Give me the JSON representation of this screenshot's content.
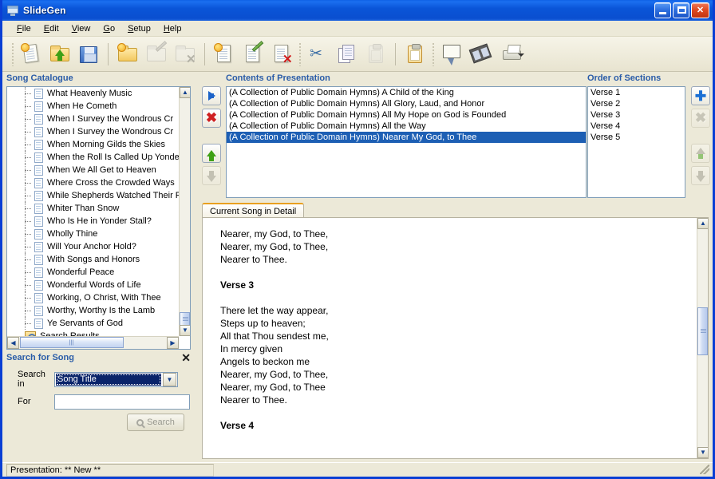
{
  "window": {
    "title": "SlideGen",
    "icon": "presentation-screen-icon",
    "controls": {
      "minimize": "Minimize",
      "maximize": "Maximize",
      "close": "Close"
    }
  },
  "menu": {
    "items": [
      {
        "label": "File",
        "accel": "F"
      },
      {
        "label": "Edit",
        "accel": "E"
      },
      {
        "label": "View",
        "accel": "V"
      },
      {
        "label": "Go",
        "accel": "G"
      },
      {
        "label": "Setup",
        "accel": "S"
      },
      {
        "label": "Help",
        "accel": "H"
      }
    ]
  },
  "toolbar": {
    "buttons": [
      {
        "name": "new-presentation-icon",
        "enabled": true
      },
      {
        "name": "open-presentation-icon",
        "enabled": true
      },
      {
        "name": "save-presentation-icon",
        "enabled": true
      },
      {
        "name": "new-folder-icon",
        "enabled": true
      },
      {
        "name": "edit-folder-icon",
        "enabled": false
      },
      {
        "name": "delete-folder-icon",
        "enabled": false
      },
      {
        "name": "new-song-icon",
        "enabled": true
      },
      {
        "name": "edit-song-icon",
        "enabled": true
      },
      {
        "name": "delete-song-icon",
        "enabled": true
      },
      {
        "name": "cut-icon",
        "enabled": true
      },
      {
        "name": "copy-icon",
        "enabled": true
      },
      {
        "name": "paste-disabled-icon",
        "enabled": false
      },
      {
        "name": "paste-icon",
        "enabled": true
      },
      {
        "name": "present-screen-icon",
        "enabled": true
      },
      {
        "name": "film-icon",
        "enabled": true
      },
      {
        "name": "print-icon",
        "enabled": true
      }
    ]
  },
  "catalogue": {
    "title": "Song Catalogue",
    "songs": [
      "What Heavenly Music",
      "When He Cometh",
      "When I Survey the Wondrous Cr",
      "When I Survey the Wondrous Cr",
      "When Morning Gilds the Skies",
      "When the Roll Is Called Up Yonde",
      "When We All Get to Heaven",
      "Where Cross the Crowded Ways",
      "While Shepherds Watched Their F",
      "Whiter Than Snow",
      "Who Is He in Yonder Stall?",
      "Wholly Thine",
      "Will Your Anchor Hold?",
      "With Songs and Honors",
      "Wonderful Peace",
      "Wonderful Words of Life",
      "Working, O Christ, With Thee",
      "Worthy, Worthy Is the Lamb",
      "Ye Servants of God"
    ],
    "search_results_node": "Search Results"
  },
  "transfer_buttons": [
    {
      "name": "add-to-presentation-button",
      "icon": "blue-right-arrow-icon",
      "enabled": true
    },
    {
      "name": "remove-from-presentation-button",
      "icon": "red-x-icon",
      "enabled": true
    },
    {
      "name": "move-up-button",
      "icon": "green-up-arrow-icon",
      "enabled": true
    },
    {
      "name": "move-down-button",
      "icon": "grey-down-arrow-icon",
      "enabled": false
    }
  ],
  "contents": {
    "title": "Contents of Presentation",
    "items": [
      {
        "text": "(A Collection of Public Domain Hymns) A Child of the King",
        "selected": false
      },
      {
        "text": "(A Collection of Public Domain Hymns) All Glory, Laud, and Honor",
        "selected": false
      },
      {
        "text": "(A Collection of Public Domain Hymns) All My Hope on God is Founded",
        "selected": false
      },
      {
        "text": "(A Collection of Public Domain Hymns) All the Way",
        "selected": false
      },
      {
        "text": "(A Collection of Public Domain Hymns) Nearer My God, to Thee",
        "selected": true
      }
    ]
  },
  "order": {
    "title": "Order of Sections",
    "items": [
      "Verse 1",
      "Verse 2",
      "Verse 3",
      "Verse 4",
      "Verse 5"
    ],
    "buttons": [
      {
        "name": "add-section-button",
        "icon": "blue-plus-icon",
        "enabled": true
      },
      {
        "name": "remove-section-button",
        "icon": "grey-x-icon",
        "enabled": false
      },
      {
        "name": "section-up-button",
        "icon": "grey-up-arrow-icon",
        "enabled": false
      },
      {
        "name": "section-down-button",
        "icon": "grey-down-arrow-icon",
        "enabled": false
      }
    ]
  },
  "detail": {
    "tab_label": "Current Song in Detail",
    "lines": [
      {
        "text": "Nearer, my God, to Thee,",
        "style": "normal"
      },
      {
        "text": "Nearer, my God, to Thee,",
        "style": "normal"
      },
      {
        "text": "Nearer to Thee.",
        "style": "normal"
      },
      {
        "text": "",
        "style": "blank"
      },
      {
        "text": "Verse 3",
        "style": "heading"
      },
      {
        "text": "",
        "style": "blank"
      },
      {
        "text": "There let the way appear,",
        "style": "normal"
      },
      {
        "text": "Steps up to heaven;",
        "style": "normal"
      },
      {
        "text": "All that Thou sendest me,",
        "style": "normal"
      },
      {
        "text": "In mercy given",
        "style": "normal"
      },
      {
        "text": "Angels to beckon me",
        "style": "normal"
      },
      {
        "text": "Nearer, my God, to Thee,",
        "style": "normal"
      },
      {
        "text": "Nearer, my God, to Thee",
        "style": "normal"
      },
      {
        "text": "Nearer to Thee.",
        "style": "normal"
      },
      {
        "text": "",
        "style": "blank"
      },
      {
        "text": "Verse 4",
        "style": "heading"
      }
    ]
  },
  "search": {
    "title": "Search for Song",
    "close_label": "✕",
    "search_in_label": "Search in",
    "search_in_value": "Song Title",
    "for_label": "For",
    "for_value": "",
    "button_label": "Search"
  },
  "statusbar": {
    "text": "Presentation: ** New **"
  },
  "colors": {
    "title_bar": "#0a4fd0",
    "panel_bg": "#ece9d8",
    "header_text": "#2a5ca8",
    "selection": "#1d5fb4",
    "tab_accent": "#e8a020"
  }
}
